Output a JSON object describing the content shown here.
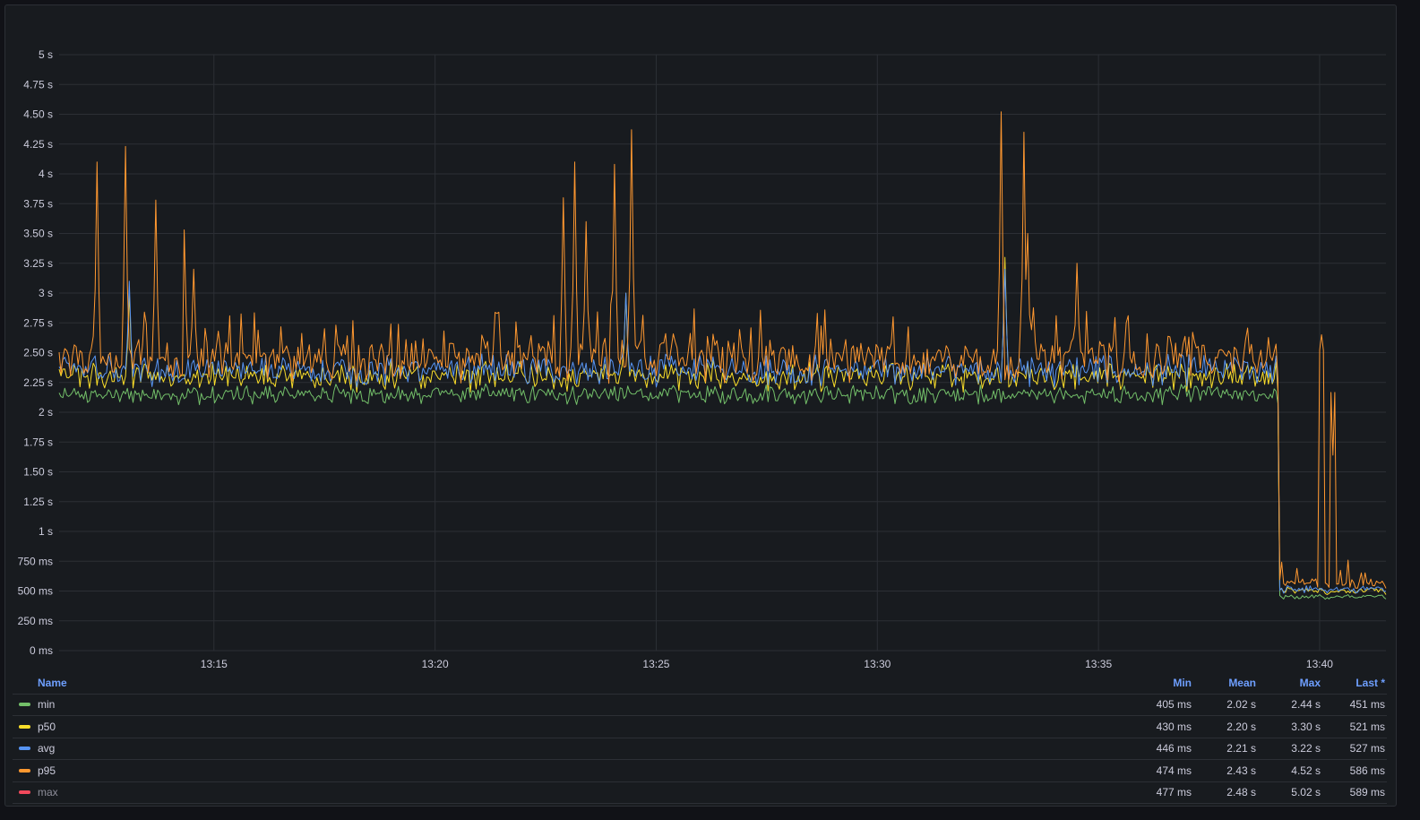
{
  "chart_data": {
    "type": "line",
    "y_ticks": [
      "0 ms",
      "250 ms",
      "500 ms",
      "750 ms",
      "1 s",
      "1.25 s",
      "1.50 s",
      "1.75 s",
      "2 s",
      "2.25 s",
      "2.50 s",
      "2.75 s",
      "3 s",
      "3.25 s",
      "3.50 s",
      "3.75 s",
      "4 s",
      "4.25 s",
      "4.50 s",
      "4.75 s",
      "5 s"
    ],
    "ylim": [
      0,
      5
    ],
    "y_unit": "s",
    "x_ticks": [
      "13:15",
      "13:20",
      "13:25",
      "13:30",
      "13:35",
      "13:40"
    ],
    "x_tick_minutes": [
      15,
      20,
      25,
      30,
      35,
      40
    ],
    "xlim_minutes": [
      11.5,
      41.5
    ],
    "grid": true,
    "legend_position": "bottom",
    "series": [
      {
        "name": "min",
        "color": "#73bf69",
        "base": 2.15,
        "noise": 0.08,
        "after": 0.45,
        "spikes": []
      },
      {
        "name": "p50",
        "color": "#fade2a",
        "base": 2.3,
        "noise": 0.12,
        "after": 0.5,
        "spikes": [
          [
            13.1,
            3.0
          ],
          [
            24.3,
            3.0
          ],
          [
            32.9,
            3.3
          ]
        ]
      },
      {
        "name": "avg",
        "color": "#5794f2",
        "base": 2.35,
        "noise": 0.13,
        "after": 0.51,
        "spikes": [
          [
            13.1,
            3.1
          ],
          [
            24.3,
            3.0
          ],
          [
            32.9,
            3.2
          ]
        ]
      },
      {
        "name": "p95",
        "color": "#ff9830",
        "base": 2.45,
        "noise": 0.2,
        "after": 0.56,
        "spikes": [
          [
            12.35,
            4.1
          ],
          [
            13.0,
            4.23
          ],
          [
            13.7,
            3.78
          ],
          [
            14.35,
            3.53
          ],
          [
            14.55,
            3.2
          ],
          [
            22.9,
            3.8
          ],
          [
            23.15,
            4.1
          ],
          [
            23.4,
            3.6
          ],
          [
            24.05,
            4.08
          ],
          [
            24.45,
            4.37
          ],
          [
            32.8,
            4.52
          ],
          [
            33.3,
            4.35
          ],
          [
            33.4,
            3.5
          ],
          [
            34.5,
            3.25
          ],
          [
            40.05,
            2.65
          ],
          [
            40.3,
            1.64
          ]
        ]
      },
      {
        "name": "max",
        "color": "#f2495c",
        "base": 2.5,
        "noise": 0.2,
        "after": 0.57,
        "hidden": true,
        "spikes": []
      }
    ],
    "drop_minute": 39.1
  },
  "legend": {
    "headers": {
      "name": "Name",
      "min": "Min",
      "mean": "Mean",
      "max": "Max",
      "last": "Last *"
    },
    "rows": [
      {
        "name": "min",
        "color": "#73bf69",
        "min": "405 ms",
        "mean": "2.02 s",
        "max": "2.44 s",
        "last": "451 ms"
      },
      {
        "name": "p50",
        "color": "#fade2a",
        "min": "430 ms",
        "mean": "2.20 s",
        "max": "3.30 s",
        "last": "521 ms"
      },
      {
        "name": "avg",
        "color": "#5794f2",
        "min": "446 ms",
        "mean": "2.21 s",
        "max": "3.22 s",
        "last": "527 ms"
      },
      {
        "name": "p95",
        "color": "#ff9830",
        "min": "474 ms",
        "mean": "2.43 s",
        "max": "4.52 s",
        "last": "586 ms"
      },
      {
        "name": "max",
        "color": "#f2495c",
        "min": "477 ms",
        "mean": "2.48 s",
        "max": "5.02 s",
        "last": "589 ms"
      }
    ]
  }
}
